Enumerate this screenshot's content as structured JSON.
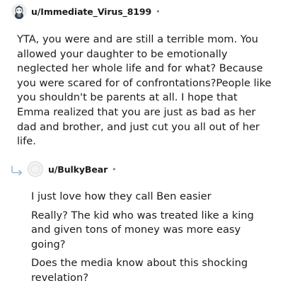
{
  "comments": [
    {
      "username": "u/Immediate_Virus_8199",
      "separator": "•",
      "avatar_icon": "snoo-avatar-icon",
      "body": "YTA, you were and are still a terrible mom. You allowed your daughter to be emotionally neglected her whole life and for what? Because you were scared for of confrontations?People like you shouldn't be parents at all. I hope that Emma realized that you are just as bad as her dad and brother, and just cut you all out of her life."
    },
    {
      "username": "u/BulkyBear",
      "separator": "•",
      "avatar_icon": "default-avatar-icon",
      "reply_icon": "reply-arrow-icon",
      "paragraphs": [
        "I just love how they call Ben easier",
        "Really? The kid who was treated like a king and given tons of money was more easy going?",
        "Does the media know about this shocking revelation?"
      ]
    }
  ],
  "colors": {
    "text": "#1c1c1c",
    "meta": "#7c7c7c",
    "reply_arrow": "#9fb7d4"
  }
}
